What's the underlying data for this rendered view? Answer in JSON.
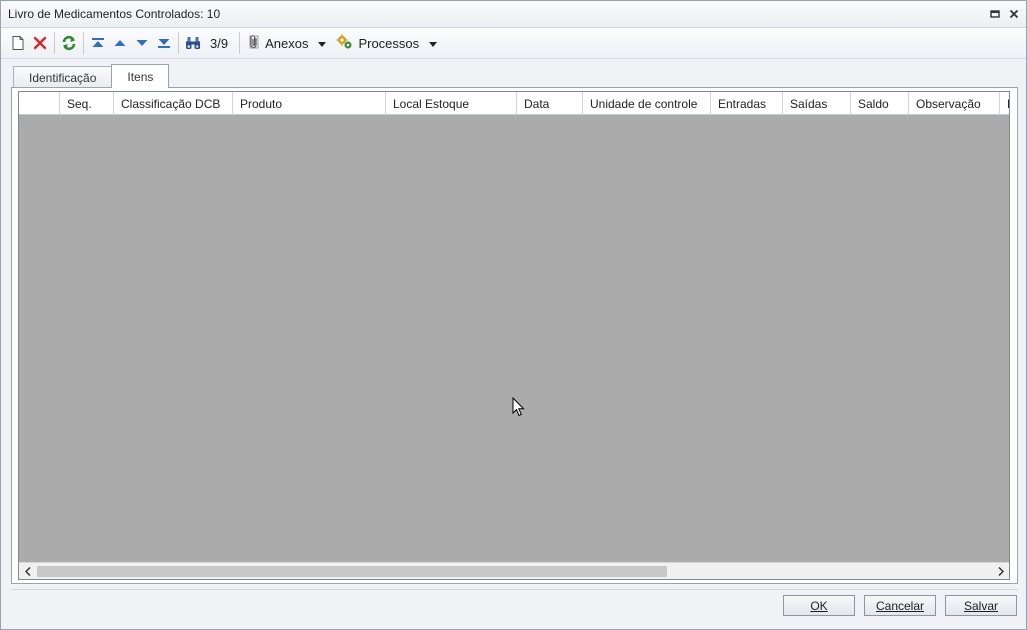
{
  "window": {
    "title": "Livro de Medicamentos Controlados: 10"
  },
  "toolbar": {
    "icons": [
      "new-document-icon",
      "delete-icon",
      "refresh-icon",
      "first-record-icon",
      "previous-record-icon",
      "next-record-icon",
      "last-record-icon",
      "search-binoculars-icon"
    ],
    "record_position": "3/9",
    "attachments_label": "Anexos",
    "processes_label": "Processos"
  },
  "tabs": [
    {
      "label": "Identificação",
      "active": false
    },
    {
      "label": "Itens",
      "active": true
    }
  ],
  "grid": {
    "columns": [
      "",
      "Seq.",
      "Classificação DCB",
      "Produto",
      "Local Estoque",
      "Data",
      "Unidade de controle",
      "Entradas",
      "Saídas",
      "Saldo",
      "Observação",
      "H"
    ],
    "rows": []
  },
  "footer": {
    "ok_label": "OK",
    "cancel_label": "Cancelar",
    "save_label": "Salvar"
  },
  "colors": {
    "grid_background": "#ababab",
    "delete_red": "#d9262a",
    "refresh_green": "#2e8b2e",
    "nav_blue": "#2f6fc4"
  }
}
